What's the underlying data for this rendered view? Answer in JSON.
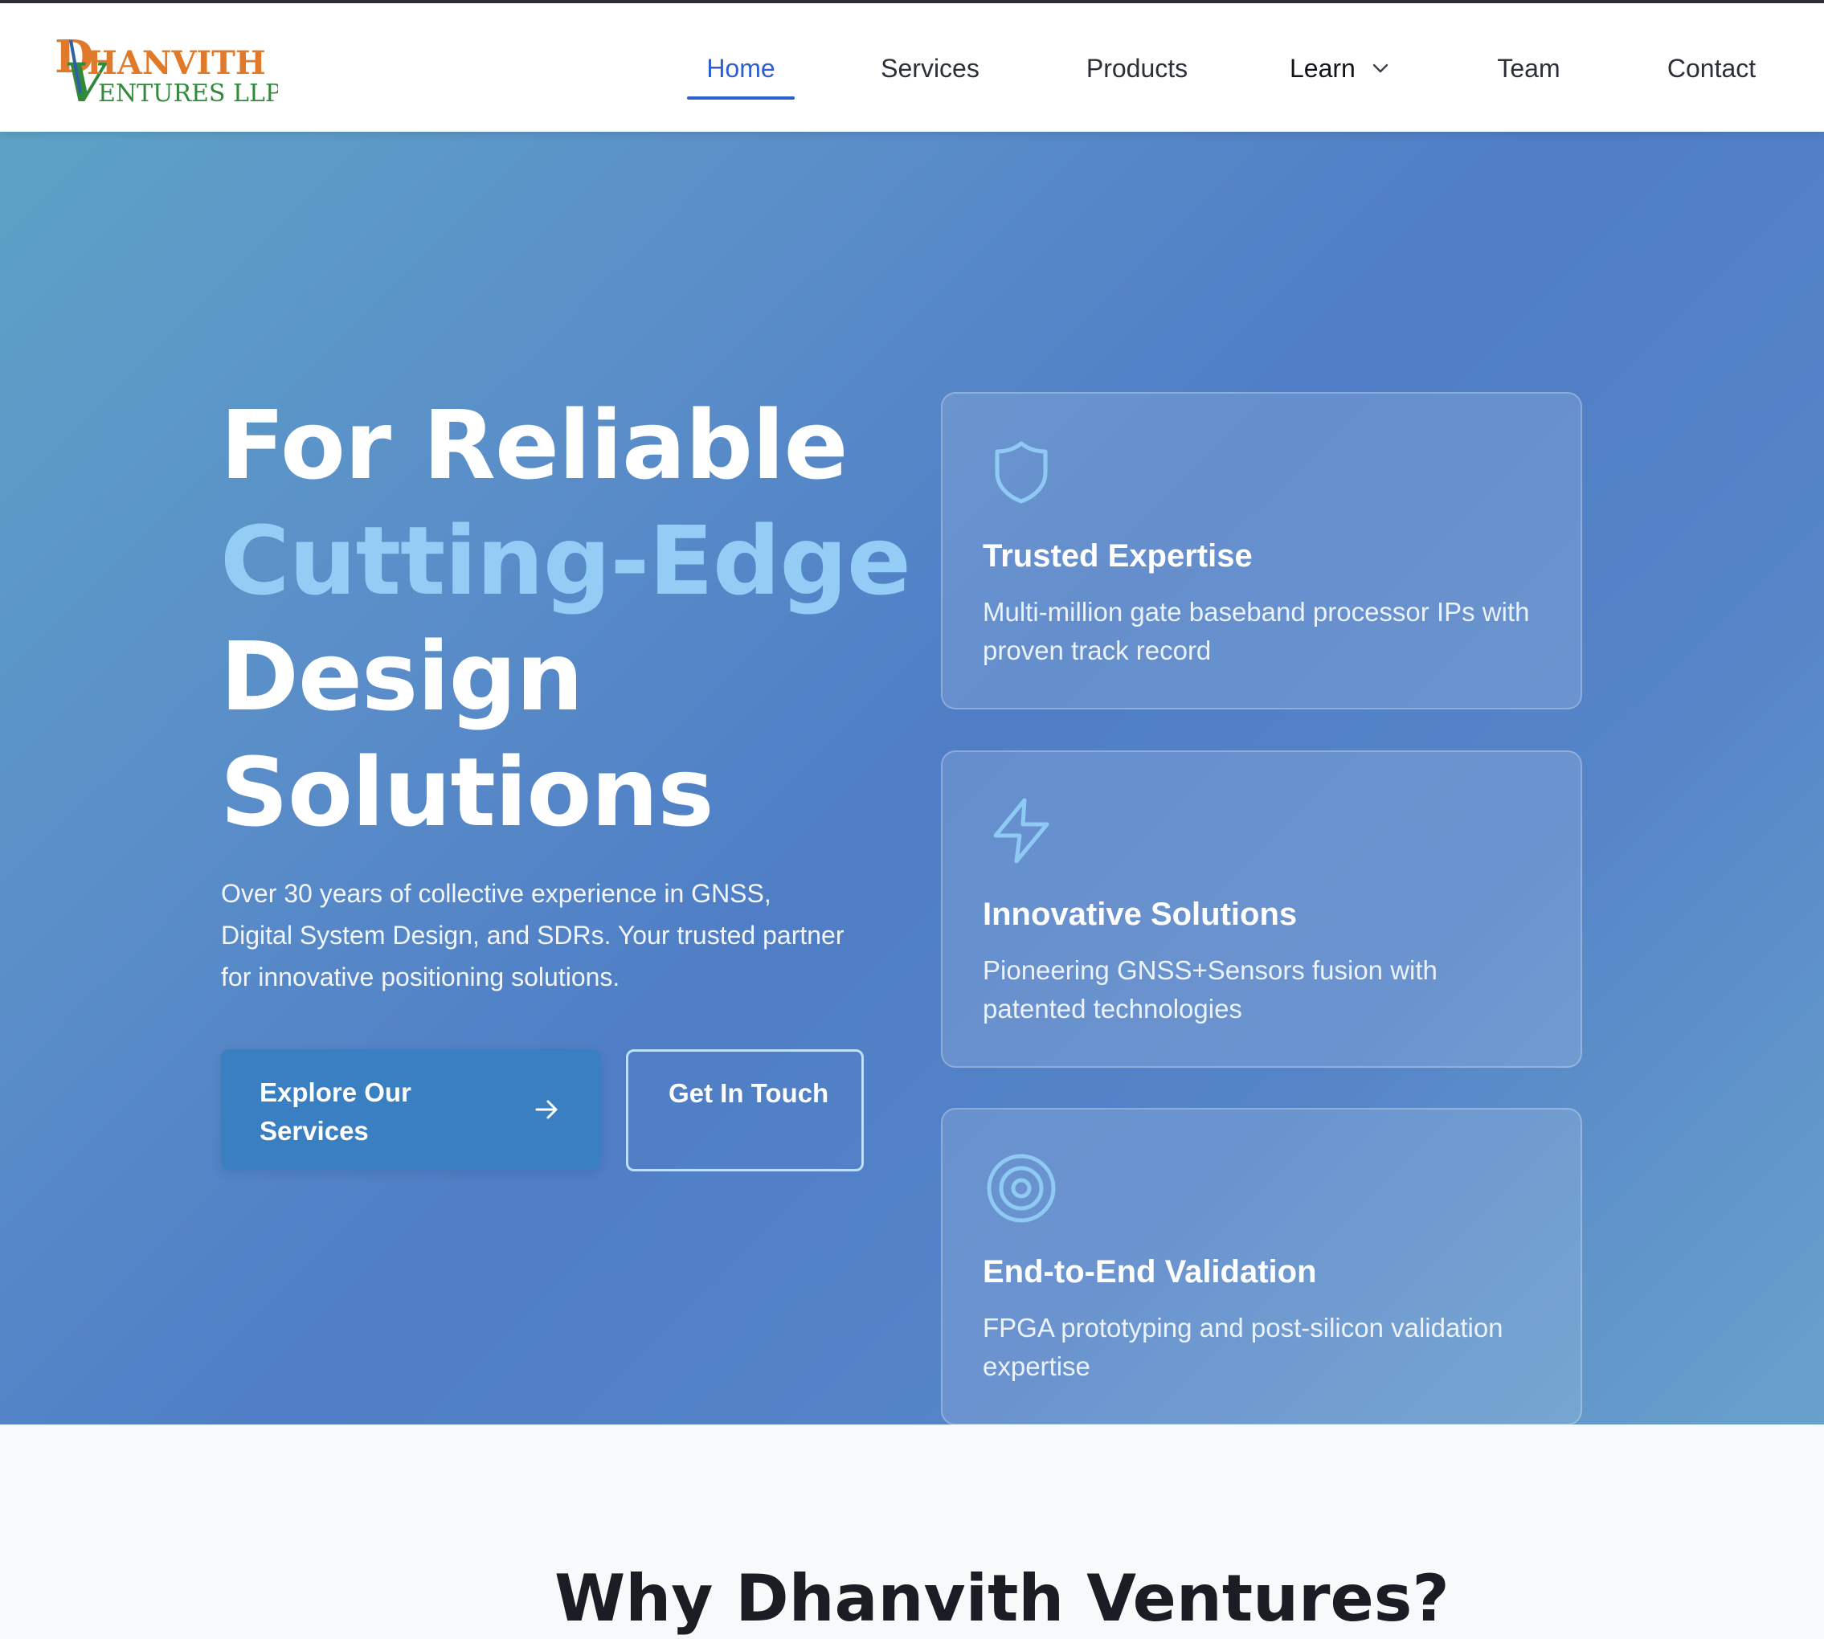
{
  "brand": {
    "logo_line1": "HANVITH",
    "logo_line2": "ENTURES LLP",
    "logo_initial_1": "D",
    "logo_initial_2": "V",
    "colors": {
      "orange": "#e07a2a",
      "green": "#2f8a3a",
      "blue": "#2f5fa8"
    }
  },
  "nav": {
    "items": [
      {
        "label": "Home",
        "active": true
      },
      {
        "label": "Services"
      },
      {
        "label": "Products"
      },
      {
        "label": "Learn",
        "has_dropdown": true,
        "dropdown_icon": "chevron-down-icon"
      },
      {
        "label": "Team"
      },
      {
        "label": "Contact"
      }
    ],
    "active_color": "#2f5fcf"
  },
  "hero": {
    "headline": {
      "line1": "For Reliable",
      "line2": "Cutting-Edge",
      "line3": "Design",
      "line4": "Solutions"
    },
    "intro": "Over 30 years of collective experience in GNSS, Digital System Design, and SDRs. Your trusted partner for innovative positioning solutions.",
    "primary_button": {
      "label": "Explore Our Services",
      "icon": "arrow-right-icon"
    },
    "secondary_button": {
      "label": "Get In Touch"
    },
    "accent_color": "#93cdf6"
  },
  "features": [
    {
      "icon": "shield-icon",
      "title": "Trusted Expertise",
      "description": "Multi-million gate baseband processor IPs with proven track record"
    },
    {
      "icon": "lightning-icon",
      "title": "Innovative Solutions",
      "description": "Pioneering GNSS+Sensors fusion with patented technologies"
    },
    {
      "icon": "target-icon",
      "title": "End-to-End Validation",
      "description": "FPGA prototyping and post-silicon validation expertise"
    }
  ],
  "next_section": {
    "heading_partial": "Why Dhanvith Ventures?"
  }
}
